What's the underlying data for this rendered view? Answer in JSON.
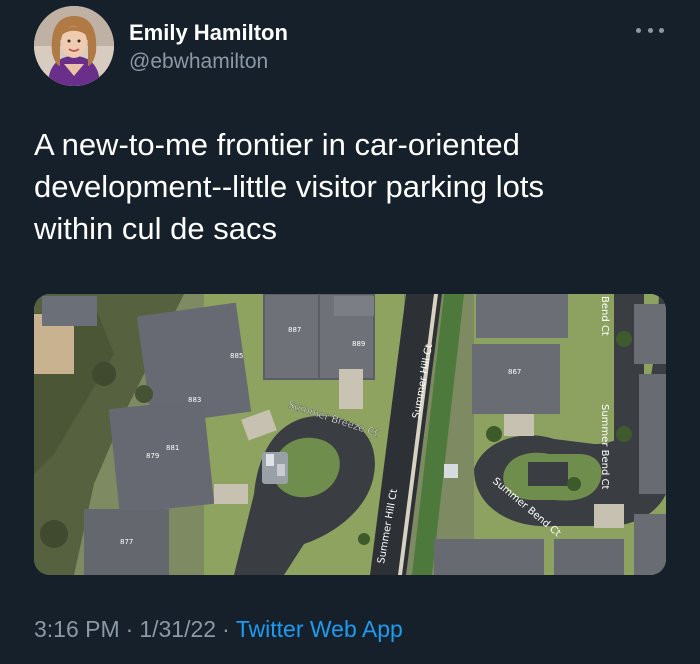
{
  "author": {
    "name": "Emily Hamilton",
    "handle": "@ebwhamilton"
  },
  "tweet": {
    "lines": [
      "A new-to-me frontier in car-oriented",
      "development--little visitor parking lots",
      "within cul de sacs"
    ],
    "time": "3:16 PM",
    "date": "1/31/22",
    "app": "Twitter Web App",
    "separator": "·"
  },
  "map_labels": {
    "road_1": "Summer Breeze Ct",
    "road_2": "Summer Hill Ct",
    "road_3": "Summer Hill Ct",
    "road_4": "Summer Bend Ct",
    "road_5": "Summer Bend Ct",
    "road_6": "Bend Ct",
    "house_1": "887",
    "house_2": "885",
    "house_3": "883",
    "house_4": "881",
    "house_5": "879",
    "house_6": "877",
    "house_7": "889",
    "house_8": "867"
  },
  "icons": {
    "more": "more-options-icon"
  },
  "colors": {
    "background": "#15202b",
    "secondary_text": "#8b98a5",
    "link": "#1d9bf0"
  }
}
